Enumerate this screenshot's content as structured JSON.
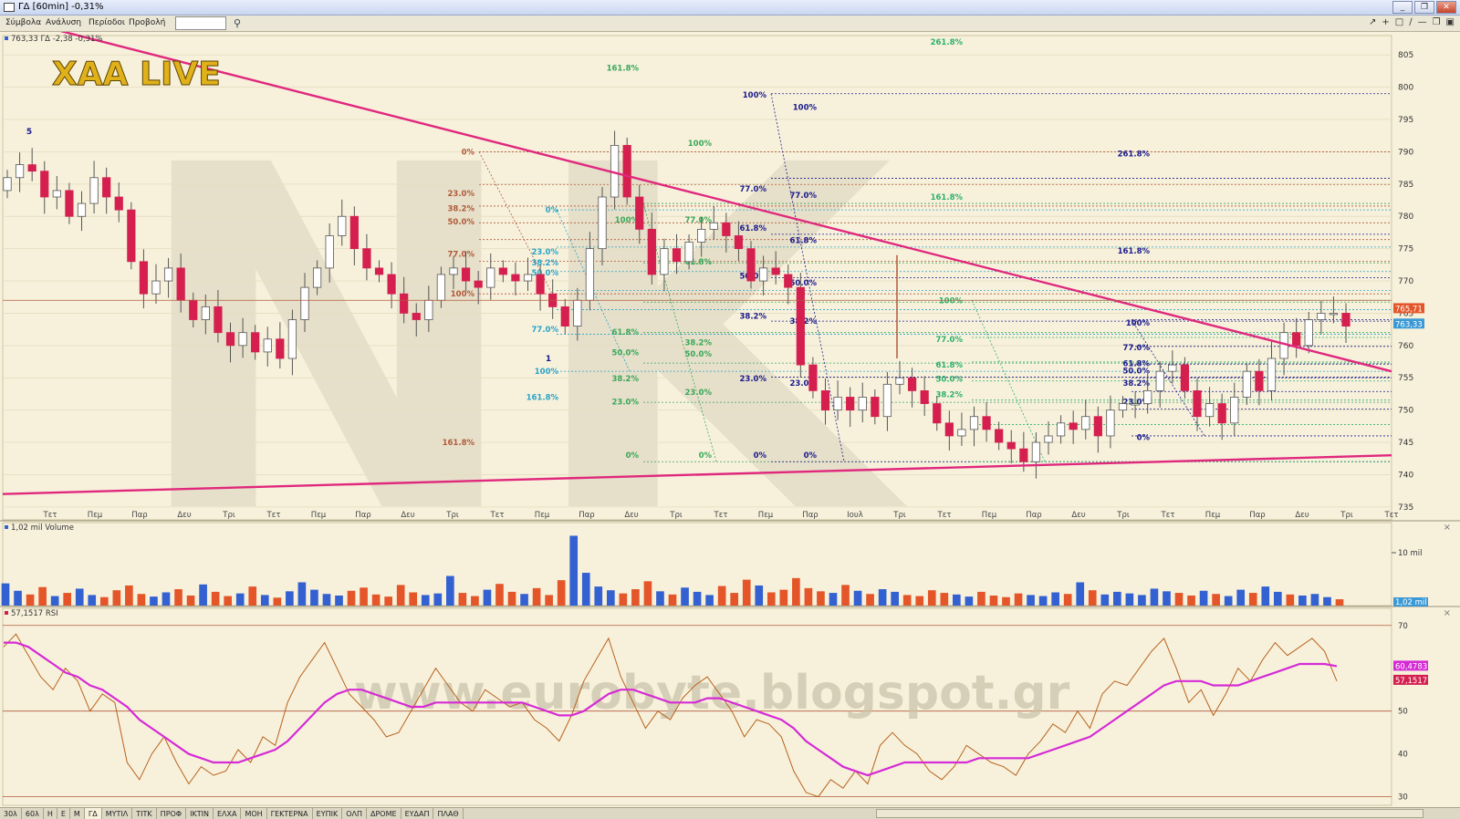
{
  "window": {
    "title": "ΓΔ [60min] -0,31%",
    "buttons": [
      "_",
      "❐",
      "✕"
    ]
  },
  "menu": {
    "items": [
      "Σύμβολα",
      "Ανάλυση",
      "Περίοδοι",
      "Προβολή"
    ],
    "symbol_value": ""
  },
  "overlays": {
    "logo": "XAA LIVE",
    "watermark_letters": "NK",
    "watermark_url": "www.eurobyte.blogspot.gr",
    "wave_labels": [
      "5",
      "1"
    ]
  },
  "colors": {
    "up": "#ffffff",
    "down": "#d5204f",
    "trendline": "#e0287d",
    "rsi": "#b8621b",
    "rsi_ma": "#d52bd5",
    "vol_up": "#3461d1",
    "vol_down": "#e4562a",
    "grid": "#e8dfc2",
    "panel_bg": "#f7f1dc"
  },
  "chart_data": [
    {
      "type": "candlestick",
      "title": "763,33 ΓΔ -2,38 -0,31%",
      "ylim": [
        733,
        808
      ],
      "y_ticks": [
        735,
        740,
        745,
        750,
        755,
        760,
        765,
        770,
        775,
        780,
        785,
        790,
        795,
        800,
        805
      ],
      "x_tick_labels": [
        "Τετ",
        "Πεμ",
        "Παρ",
        "Δευ",
        "Τρι",
        "Τετ",
        "Πεμ",
        "Παρ",
        "Δευ",
        "Τρι",
        "Τετ",
        "Πεμ",
        "Παρ",
        "Δευ",
        "Τρι",
        "Τετ",
        "Πεμ",
        "Παρ",
        "Ιουλ",
        "Τρι",
        "Τετ",
        "Πεμ",
        "Παρ",
        "Δευ",
        "Τρι",
        "Τετ",
        "Πεμ",
        "Παρ",
        "Δευ",
        "Τρι",
        "Τετ"
      ],
      "price_tags": [
        {
          "label": "765,71",
          "value": 765.71,
          "color": "#e4562a"
        },
        {
          "label": "763,33",
          "value": 763.33,
          "color": "#3b9ad6"
        }
      ],
      "close_path": [
        786,
        788,
        787,
        783,
        784,
        780,
        782,
        786,
        783,
        781,
        773,
        768,
        770,
        772,
        767,
        764,
        766,
        762,
        760,
        762,
        759,
        761,
        758,
        764,
        769,
        772,
        777,
        780,
        775,
        772,
        771,
        768,
        765,
        764,
        767,
        771,
        772,
        770,
        769,
        772,
        771,
        770,
        771,
        768,
        766,
        763,
        767,
        775,
        783,
        791,
        783,
        778,
        771,
        775,
        773,
        776,
        778,
        779,
        777,
        775,
        770,
        772,
        771,
        769,
        757,
        753,
        750,
        752,
        750,
        752,
        749,
        754,
        755,
        753,
        751,
        748,
        746,
        747,
        749,
        747,
        745,
        744,
        742,
        745,
        746,
        748,
        747,
        749,
        746,
        750,
        751,
        751,
        753,
        756,
        757,
        753,
        749,
        751,
        748,
        752,
        756,
        753,
        758,
        762,
        760,
        764,
        765,
        765,
        763
      ],
      "trendlines": [
        {
          "from": [
            0,
            811
          ],
          "to": [
            1,
            756
          ]
        },
        {
          "from": [
            0,
            737
          ],
          "to": [
            1,
            743
          ]
        }
      ],
      "fib_labels": [
        "0%",
        "23.0%",
        "38.2%",
        "50.0%",
        "61.8%",
        "77.0%",
        "100%",
        "161.8%",
        "261.8%"
      ]
    },
    {
      "type": "bar",
      "title": "1,02 mil Volume",
      "y_tick_label": "10 mil",
      "last_value_label": "1,02 mil",
      "ylim": [
        0,
        15
      ],
      "values": [
        4.2,
        2.8,
        2.1,
        3.5,
        1.8,
        2.4,
        3.2,
        2.0,
        1.6,
        2.9,
        3.8,
        2.2,
        1.7,
        2.5,
        3.1,
        1.9,
        4.0,
        2.6,
        1.8,
        2.3,
        3.6,
        2.0,
        1.5,
        2.7,
        4.4,
        3.0,
        2.2,
        1.9,
        2.8,
        3.4,
        2.1,
        1.7,
        3.9,
        2.5,
        2.0,
        2.3,
        5.6,
        2.4,
        1.8,
        3.0,
        4.1,
        2.6,
        2.2,
        3.3,
        2.0,
        4.8,
        13.2,
        6.2,
        3.6,
        2.9,
        2.3,
        3.1,
        4.6,
        2.7,
        2.1,
        3.4,
        2.6,
        2.0,
        3.7,
        2.4,
        4.9,
        3.8,
        2.5,
        3.0,
        5.2,
        3.3,
        2.7,
        2.4,
        3.9,
        2.8,
        2.2,
        3.1,
        2.6,
        2.0,
        1.8,
        2.9,
        2.4,
        2.1,
        1.7,
        2.6,
        1.9,
        1.6,
        2.3,
        2.0,
        1.8,
        2.5,
        2.2,
        4.4,
        2.9,
        2.1,
        2.6,
        2.3,
        2.0,
        3.2,
        2.7,
        2.4,
        1.9,
        2.8,
        2.2,
        1.8,
        3.0,
        2.4,
        3.6,
        2.6,
        2.1,
        1.9,
        2.2,
        1.6,
        1.2
      ]
    },
    {
      "type": "line",
      "title": "57,1517 RSI",
      "ylim": [
        28,
        74
      ],
      "y_ticks": [
        30,
        40,
        50,
        60,
        70
      ],
      "levels": [
        30,
        50,
        70
      ],
      "series": [
        {
          "name": "RSI",
          "last_label": "57,1517",
          "values": [
            65,
            68,
            63,
            58,
            55,
            60,
            57,
            50,
            54,
            52,
            38,
            34,
            40,
            44,
            38,
            33,
            37,
            35,
            36,
            41,
            38,
            44,
            42,
            52,
            58,
            62,
            66,
            60,
            54,
            51,
            48,
            44,
            45,
            50,
            55,
            60,
            56,
            52,
            50,
            55,
            53,
            51,
            52,
            48,
            46,
            43,
            49,
            57,
            62,
            67,
            58,
            52,
            46,
            50,
            48,
            53,
            56,
            58,
            54,
            50,
            44,
            48,
            47,
            44,
            36,
            31,
            30,
            34,
            32,
            36,
            33,
            42,
            45,
            42,
            40,
            36,
            34,
            37,
            42,
            40,
            38,
            37,
            35,
            40,
            43,
            47,
            45,
            50,
            46,
            54,
            57,
            56,
            60,
            64,
            67,
            60,
            52,
            55,
            49,
            54,
            60,
            57,
            62,
            66,
            63,
            65,
            67,
            64,
            57
          ]
        },
        {
          "name": "MA",
          "last_label": "60,4783",
          "values": [
            66,
            66,
            65,
            63,
            61,
            59,
            58,
            56,
            55,
            53,
            51,
            48,
            46,
            44,
            42,
            40,
            39,
            38,
            38,
            38,
            39,
            40,
            41,
            43,
            46,
            49,
            52,
            54,
            55,
            55,
            54,
            53,
            52,
            51,
            51,
            52,
            52,
            52,
            52,
            52,
            52,
            52,
            52,
            51,
            50,
            49,
            49,
            50,
            52,
            54,
            55,
            55,
            54,
            53,
            52,
            52,
            52,
            53,
            53,
            52,
            51,
            50,
            49,
            48,
            46,
            43,
            41,
            39,
            37,
            36,
            35,
            36,
            37,
            38,
            38,
            38,
            38,
            38,
            38,
            39,
            39,
            39,
            39,
            39,
            40,
            41,
            42,
            43,
            44,
            46,
            48,
            50,
            52,
            54,
            56,
            57,
            57,
            57,
            56,
            56,
            56,
            57,
            58,
            59,
            60,
            61,
            61,
            61,
            60.5
          ]
        }
      ]
    }
  ],
  "bottom_tabs": [
    "30λ",
    "60λ",
    "Η",
    "Ε",
    "Μ",
    "ΓΔ",
    "ΜΥΤΙΛ",
    "ΤΙΤΚ",
    "ΠΡΟΦ",
    "ΙΚΤΙΝ",
    "ΕΛΧΑ",
    "ΜΟΗ",
    "ΓΕΚΤΕΡΝΑ",
    "ΕΥΠΙΚ",
    "ΟΛΠ",
    "ΔΡΟΜΕ",
    "ΕΥΔΑΠ",
    "ΠΛΑΘ"
  ]
}
